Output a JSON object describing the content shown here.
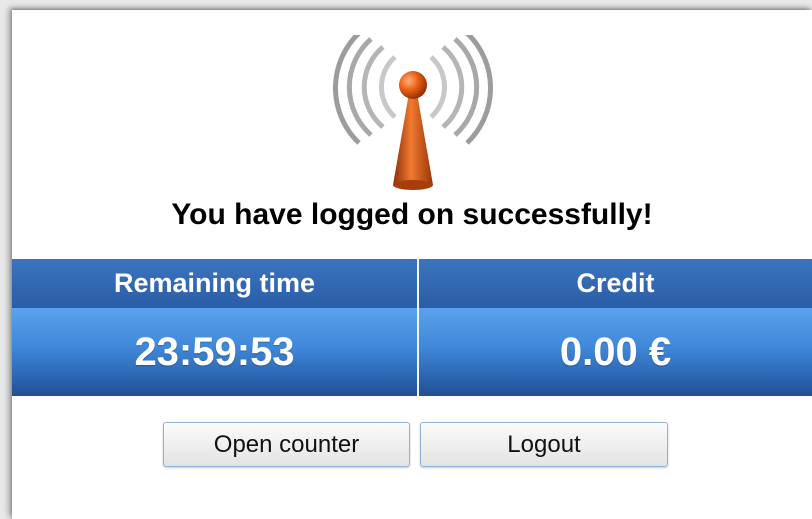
{
  "status": {
    "headline": "You have logged on successfully!"
  },
  "icons": {
    "antenna": "wireless-antenna-icon"
  },
  "session": {
    "remaining_label": "Remaining time",
    "remaining_value": "23:59:53",
    "credit_label": "Credit",
    "credit_value": "0.00 €"
  },
  "actions": {
    "open_counter_label": "Open counter",
    "logout_label": "Logout"
  },
  "colors": {
    "header_blue": "#2f67b2",
    "value_blue": "#3f87d8",
    "antenna_orange": "#d9541a"
  }
}
